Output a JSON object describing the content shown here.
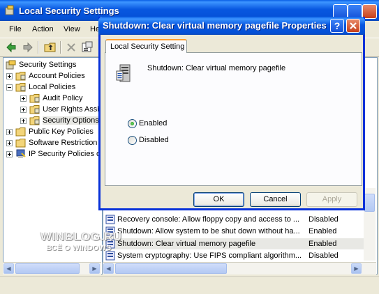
{
  "main_window": {
    "title": "Local Security Settings",
    "menu": [
      "File",
      "Action",
      "View",
      "He"
    ]
  },
  "tree": {
    "items": [
      {
        "label": "Security Settings",
        "level": 0,
        "expander": "none"
      },
      {
        "label": "Account Policies",
        "level": 1,
        "expander": "plus"
      },
      {
        "label": "Local Policies",
        "level": 1,
        "expander": "minus"
      },
      {
        "label": "Audit Policy",
        "level": 2,
        "expander": "plus"
      },
      {
        "label": "User Rights Assi",
        "level": 2,
        "expander": "plus"
      },
      {
        "label": "Security Options",
        "level": 2,
        "expander": "plus"
      },
      {
        "label": "Public Key Policies",
        "level": 1,
        "expander": "plus"
      },
      {
        "label": "Software Restriction",
        "level": 1,
        "expander": "plus"
      },
      {
        "label": "IP Security Policies o",
        "level": 1,
        "expander": "plus"
      }
    ]
  },
  "list": {
    "rows": [
      {
        "policy": "Recovery console: Allow floppy copy and access to ...",
        "setting": "Disabled"
      },
      {
        "policy": "Shutdown: Allow system to be shut down without ha...",
        "setting": "Enabled"
      },
      {
        "policy": "Shutdown: Clear virtual memory pagefile",
        "setting": "Enabled"
      },
      {
        "policy": "System cryptography: Use FIPS compliant algorithm...",
        "setting": "Disabled"
      }
    ]
  },
  "watermark": {
    "main": "WINBLOG.RU",
    "sub": "ВСЁ О WINDOWS"
  },
  "dialog": {
    "title": "Shutdown: Clear virtual memory pagefile Properties",
    "help_label": "?",
    "tab_label": "Local Security Setting",
    "policy_name": "Shutdown: Clear virtual memory pagefile",
    "options": [
      {
        "label": "Enabled",
        "checked": true
      },
      {
        "label": "Disabled",
        "checked": false
      }
    ],
    "ok_label": "OK",
    "cancel_label": "Cancel",
    "apply_label": "Apply"
  },
  "colors": {
    "titlebar": "#0857e0",
    "dialog_border": "#0831d9",
    "tab_accent": "#ff9f2e",
    "window_bg": "#ece9d8"
  }
}
